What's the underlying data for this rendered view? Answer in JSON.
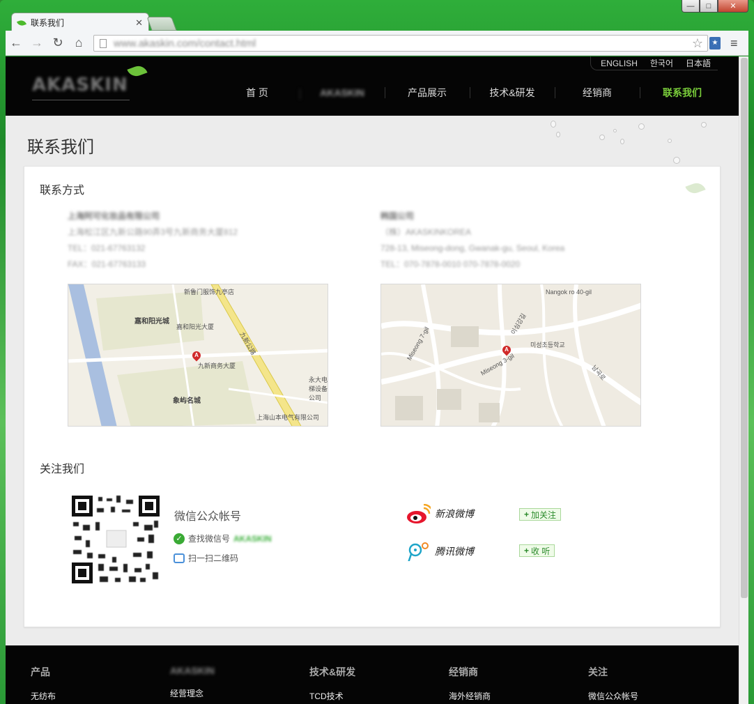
{
  "browser": {
    "tab_title": "联系我们",
    "url": "www.akaskin.com/contact.html",
    "controls": {
      "minimize": "—",
      "maximize": "□",
      "close": "✕"
    }
  },
  "site": {
    "logo_text": "AKASKIN",
    "languages": [
      "ENGLISH",
      "한국어",
      "日本語"
    ],
    "nav": [
      {
        "label": "首 页",
        "active": false
      },
      {
        "label": "AKASKIN",
        "active": false,
        "blurred": true
      },
      {
        "label": "产品展示",
        "active": false
      },
      {
        "label": "技术&研发",
        "active": false
      },
      {
        "label": "经销商",
        "active": false
      },
      {
        "label": "联系我们",
        "active": true
      }
    ],
    "page_title": "联系我们"
  },
  "contact": {
    "section_title": "联系方式",
    "shanghai": {
      "company": "上海阿可化妆品有限公司",
      "address": "上海松江区九新公路90弄3号九新商务大厦812",
      "tel": "TEL：021-67763132",
      "fax": "FAX：021-67763133"
    },
    "korea": {
      "company": "韩国公司",
      "name": "（株）AKASKINKOREA",
      "address": "728-13, Miseong-dong, Gwanak-gu, Seoul, Korea",
      "tel": "TEL：070-7878-0010 070-7878-0020"
    },
    "map1_labels": {
      "a": "新鲁门服饰九亭店",
      "b": "嘉和阳光城",
      "c": "嘉和阳光大厦",
      "d": "九新商务大厦",
      "e": "象屿名城",
      "f": "永大电梯设备公司",
      "g": "上海山本电气有限公司",
      "road": "九新公路",
      "marker": "A"
    },
    "map2_labels": {
      "a": "Nangok ro 40-gil",
      "b": "Miseong 7-gil",
      "c": "Miseong 3-gil",
      "d": "이심강길",
      "e": "미성초등학교",
      "f": "남곡로",
      "marker": "A"
    }
  },
  "follow": {
    "section_title": "关注我们",
    "wechat_title": "微信公众帐号",
    "wechat_find": "查找微信号",
    "wechat_id": "AKASKIN",
    "wechat_scan": "扫一扫二维码",
    "sina_name": "新浪微博",
    "sina_button": "加关注",
    "tencent_name": "腾讯微博",
    "tencent_button": "收 听"
  },
  "footer": {
    "columns": [
      {
        "head": "产品",
        "link": "无纺布"
      },
      {
        "head": "AKASKIN",
        "link": "经营理念",
        "blurred": true
      },
      {
        "head": "技术&研发",
        "link": "TCD技术"
      },
      {
        "head": "经销商",
        "link": "海外经销商"
      },
      {
        "head": "关注",
        "link": "微信公众帐号"
      }
    ]
  },
  "colors": {
    "accent_green": "#7bcf3b",
    "header_bg": "#050505",
    "page_bg": "#ececec",
    "follow_btn_bg": "#effbe8"
  }
}
